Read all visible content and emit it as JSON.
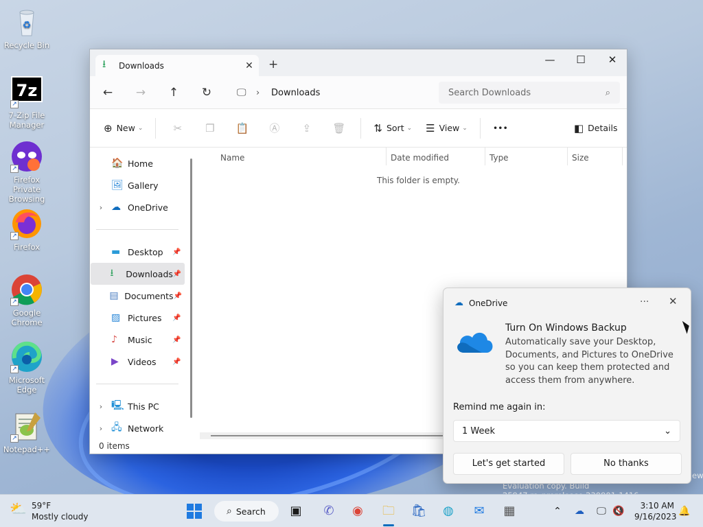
{
  "desktop": {
    "icons": [
      {
        "label": "Recycle Bin",
        "icon": "recycle-bin-icon"
      },
      {
        "label": "7-Zip File Manager",
        "icon": "7zip-icon"
      },
      {
        "label": "Firefox Private Browsing",
        "icon": "firefox-private-icon"
      },
      {
        "label": "Firefox",
        "icon": "firefox-icon"
      },
      {
        "label": "Google Chrome",
        "icon": "chrome-icon"
      },
      {
        "label": "Microsoft Edge",
        "icon": "edge-icon"
      },
      {
        "label": "Notepad++",
        "icon": "notepadpp-icon"
      }
    ],
    "seven_zip_glyph": "7z",
    "watermark": "Evaluation copy. Build 25947.rs_prerelease.230901-1416",
    "watermark_fragment": "ew"
  },
  "explorer": {
    "tab_title": "Downloads",
    "tab_close": "✕",
    "new_tab": "+",
    "window_controls": {
      "minimize": "—",
      "maximize": "☐",
      "close": "✕"
    },
    "nav": {
      "back": "←",
      "forward": "→",
      "up": "↑",
      "refresh": "↻"
    },
    "address": {
      "location": "Downloads",
      "separator": "›"
    },
    "search_placeholder": "Search Downloads",
    "commands": {
      "new_label": "New",
      "sort_label": "Sort",
      "view_label": "View",
      "more_label": "•••",
      "details_label": "Details"
    },
    "sidebar": {
      "top": [
        {
          "label": "Home",
          "icon": "home-icon"
        },
        {
          "label": "Gallery",
          "icon": "gallery-icon"
        },
        {
          "label": "OneDrive",
          "icon": "onedrive-icon"
        }
      ],
      "pinned": [
        {
          "label": "Desktop",
          "icon": "desktop-folder-icon"
        },
        {
          "label": "Downloads",
          "icon": "downloads-folder-icon",
          "selected": true
        },
        {
          "label": "Documents",
          "icon": "documents-folder-icon"
        },
        {
          "label": "Pictures",
          "icon": "pictures-folder-icon"
        },
        {
          "label": "Music",
          "icon": "music-folder-icon"
        },
        {
          "label": "Videos",
          "icon": "videos-folder-icon"
        }
      ],
      "bottom": [
        {
          "label": "This PC",
          "icon": "this-pc-icon"
        },
        {
          "label": "Network",
          "icon": "network-icon"
        }
      ]
    },
    "columns": [
      "Name",
      "Date modified",
      "Type",
      "Size"
    ],
    "empty_message": "This folder is empty.",
    "status": "0 items"
  },
  "onedrive_toast": {
    "app_name": "OneDrive",
    "more": "···",
    "close": "✕",
    "title": "Turn On Windows Backup",
    "body": "Automatically save your Desktop, Documents, and Pictures to OneDrive so you can keep them protected and access them from anywhere.",
    "remind_label": "Remind me again in:",
    "remind_value": "1 Week",
    "primary_button": "Let's get started",
    "secondary_button": "No thanks"
  },
  "taskbar": {
    "weather_temp": "59°F",
    "weather_desc": "Mostly cloudy",
    "search_label": "Search",
    "time": "3:10 AM",
    "date": "9/16/2023"
  },
  "colors": {
    "accent": "#0f6cbd",
    "downloads_green": "#2aa05a"
  }
}
